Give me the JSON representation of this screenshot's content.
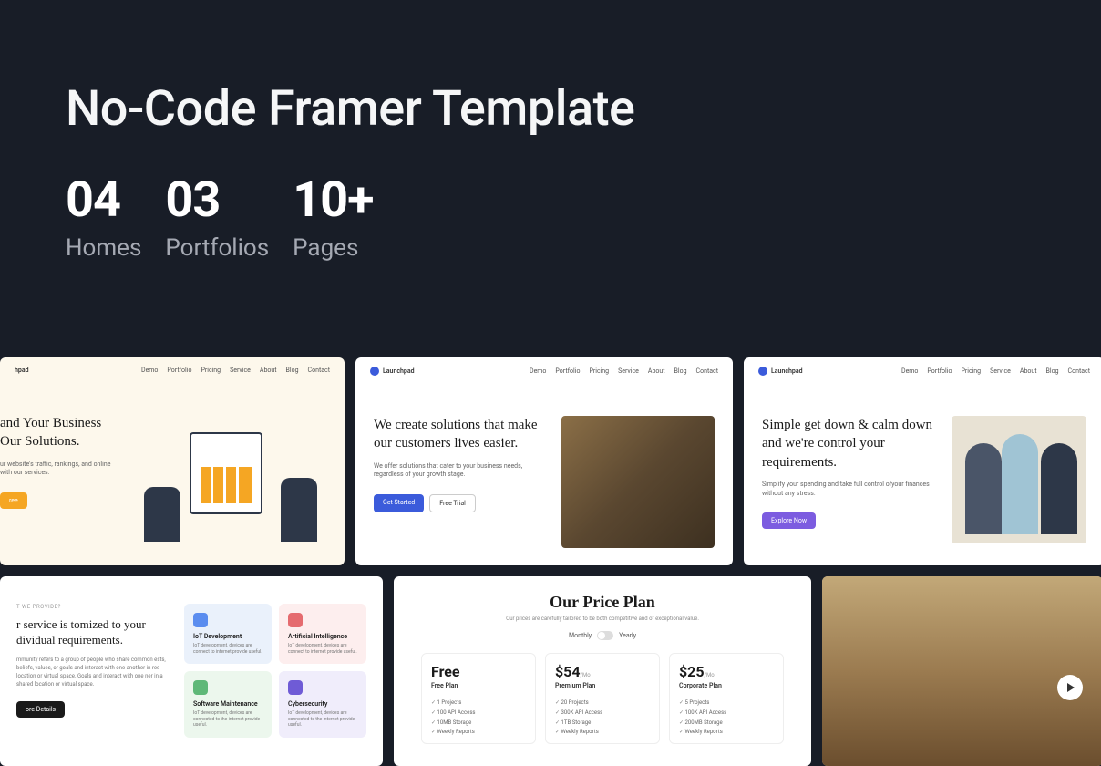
{
  "hero": {
    "title": "No-Code Framer Template",
    "stats": [
      {
        "num": "04",
        "label": "Homes"
      },
      {
        "num": "03",
        "label": "Portfolios"
      },
      {
        "num": "10+",
        "label": "Pages"
      }
    ]
  },
  "nav": {
    "logo": "Launchpad",
    "items": [
      "Demo",
      "Portfolio",
      "Pricing",
      "Service",
      "About",
      "Blog",
      "Contact"
    ]
  },
  "thumbs": {
    "t1": {
      "headline": "and Your Business Our Solutions.",
      "sub": "ur website's traffic, rankings, and online with our services.",
      "btn": "ree"
    },
    "t2": {
      "headline": "We create solutions that make our customers lives easier.",
      "sub": "We offer solutions that cater to your business needs, regardless of your growth stage.",
      "btn1": "Get Started",
      "btn2": "Free Trial"
    },
    "t3": {
      "headline": "Simple get down & calm down and we're control your requirements.",
      "sub": "Simplify your spending and take full control ofyour finances without any stress.",
      "btn": "Explore Now"
    },
    "t4": {
      "label": "T WE PROVIDE?",
      "headline": "r service is tomized to your dividual requirements.",
      "sub": "mmunity refers to a group of people who share common ests, beliefs, values, or goals and interact with one another in red location or virtual space. Goals and interact with one ner in a shared location or virtual space.",
      "btn": "ore Details",
      "cards": [
        {
          "title": "IoT Development",
          "desc": "IoT development, devices are connect to internet provide useful."
        },
        {
          "title": "Artificial Intelligence",
          "desc": "IoT development, devices are connect to internet provide useful."
        },
        {
          "title": "Software Maintenance",
          "desc": "IoT development, devices are connected to the internet provide useful."
        },
        {
          "title": "Cybersecurity",
          "desc": "IoT development, devices are connected to the internet provide useful."
        }
      ]
    },
    "t5": {
      "title": "Our Price Plan",
      "sub": "Our prices are carefully tailored to be both competitive and of exceptional value.",
      "toggle": {
        "monthly": "Monthly",
        "yearly": "Yearly"
      },
      "plans": [
        {
          "price": "Free",
          "name": "Free Plan",
          "features": [
            "1 Projects",
            "100 API Access",
            "10MB Storage",
            "Weekly Reports"
          ]
        },
        {
          "price": "$54",
          "unit": "/Mo",
          "name": "Premium Plan",
          "features": [
            "20 Projects",
            "300K API Access",
            "1TB Storage",
            "Weekly Reports"
          ]
        },
        {
          "price": "$25",
          "unit": "/Mo",
          "name": "Corporate Plan",
          "features": [
            "5 Projects",
            "100K API Access",
            "200MB Storage",
            "Weekly Reports"
          ]
        }
      ]
    }
  }
}
